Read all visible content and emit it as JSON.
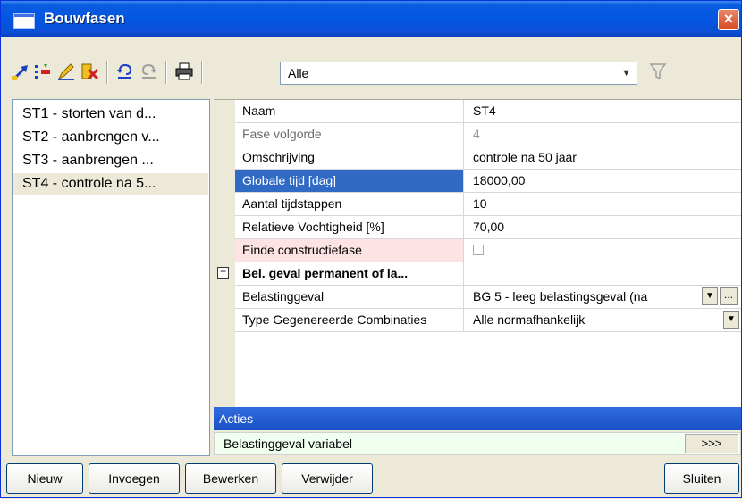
{
  "window": {
    "title": "Bouwfasen",
    "close_label": "×"
  },
  "toolbar": {
    "buttons": [
      {
        "icon": "new-stage-icon"
      },
      {
        "icon": "insert-icon"
      },
      {
        "icon": "edit-icon"
      },
      {
        "icon": "delete-icon"
      },
      {
        "icon": "undo-icon"
      },
      {
        "icon": "redo-icon"
      },
      {
        "icon": "print-icon"
      }
    ],
    "filter_value": "Alle",
    "filter_icon": "filter-funnel-icon"
  },
  "phase_list": [
    {
      "label": "ST1 - storten van d..."
    },
    {
      "label": "ST2 - aanbrengen v..."
    },
    {
      "label": "ST3 - aanbrengen ..."
    },
    {
      "label": "ST4 - controle na 5..."
    }
  ],
  "properties": {
    "naam": {
      "label": "Naam",
      "value": "ST4"
    },
    "fase_volgorde": {
      "label": "Fase volgorde",
      "value": "4"
    },
    "omschrijving": {
      "label": "Omschrijving",
      "value": "controle na 50 jaar"
    },
    "globale_tijd": {
      "label": "Globale tijd [dag]",
      "value": "18000,00"
    },
    "aantal_tijdstappen": {
      "label": "Aantal tijdstappen",
      "value": "10"
    },
    "relatieve_vochtigheid": {
      "label": "Relatieve Vochtigheid [%]",
      "value": "70,00"
    },
    "einde_constructiefase": {
      "label": "Einde constructiefase",
      "checked": false
    },
    "category": {
      "label": "Bel. geval permanent of la...",
      "toggle": "−"
    },
    "belastinggeval": {
      "label": "Belastinggeval",
      "value": "BG 5 - leeg belastingsgeval (na"
    },
    "type_combinaties": {
      "label": "Type Gegenereerde Combinaties",
      "value": "Alle normafhankelijk"
    }
  },
  "actions": {
    "header": "Acties",
    "row_label": "Belastinggeval variabel",
    "row_button": ">>>"
  },
  "buttons": {
    "nieuw": "Nieuw",
    "invoegen": "Invoegen",
    "bewerken": "Bewerken",
    "verwijder": "Verwijder",
    "sluiten": "Sluiten"
  },
  "colors": {
    "title_bar": "#0a5be0",
    "selection": "#316ac5",
    "actions_header": "#1a50c6"
  }
}
